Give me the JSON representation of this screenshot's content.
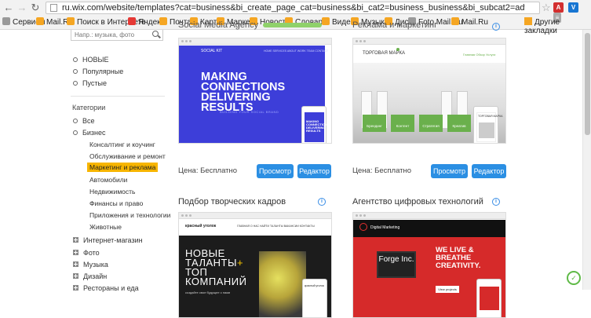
{
  "browser": {
    "url": "ru.wix.com/website/templates?cat=business&bi_create_page_cat=business&bi_cat2=business_business&bi_subcat2=advertising-marketing_advertising-m",
    "bookmarks": [
      "Сервисы",
      "Mail.Ru",
      "Поиск в Интернете",
      "Яндекс",
      "Почта",
      "Карты",
      "Маркет",
      "Новости",
      "Словари",
      "Видео",
      "Музыка",
      "Диск",
      "Foto.Mail.Ru",
      "Mail.Ru"
    ],
    "other_bookmarks": "Другие закладки"
  },
  "sidebar": {
    "search_placeholder": "Напр.: музыка, фото",
    "filters": [
      "НОВЫЕ",
      "Популярные",
      "Пустые"
    ],
    "categories_heading": "Категории",
    "categories": [
      {
        "label": "Все"
      },
      {
        "label": "Бизнес"
      },
      {
        "label": "Интернет-магазин"
      },
      {
        "label": "Фото"
      },
      {
        "label": "Музыка"
      },
      {
        "label": "Дизайн"
      },
      {
        "label": "Рестораны и еда"
      }
    ],
    "business_subcategories": [
      "Консалтинг и коучинг",
      "Обслуживание и ремонт",
      "Маркетинг и реклама",
      "Автомобили",
      "Недвижимость",
      "Финансы и право",
      "Приложения и технологии",
      "Животные"
    ]
  },
  "cards": [
    {
      "title": "Social Media Agency",
      "price": "Цена: Бесплатно",
      "view_label": "Просмотр",
      "edit_label": "Редактор",
      "preview": {
        "logo": "SOCIAL KIT",
        "nav": "HOME   SERVICES   ABOUT   WORK   TEAM   CONTACT",
        "headline": "MAKING CONNECTIONS DELIVERING RESULTS",
        "sub": "BUILDING YOUR SOCIAL BRAND",
        "phone_text": "MAKING CONNECTIONS DELIVERING RESULTS"
      }
    },
    {
      "title": "Реклама и маркетинг",
      "price": "Цена: Бесплатно",
      "view_label": "Просмотр",
      "edit_label": "Редактор",
      "preview": {
        "brand": "ТОРГОВАЯ МАРКА",
        "nav": "Главная   Обзор   Услуги",
        "tiles": [
          "Брендинг",
          "Контент",
          "Стратегия",
          "Креатив"
        ],
        "phone_brand": "ТОРГОВАЯ МАРКА"
      }
    },
    {
      "title": "Подбор творческих кадров",
      "preview": {
        "brand": "красный уголок",
        "nav": "ГЛАВНАЯ   О НАС   НАЙТИ ТАЛАНТЫ   ВАКАНСИИ   КОНТАКТЫ",
        "headline_lines": [
          "НОВЫЕ",
          "ТАЛАНТЫ",
          "ТОП",
          "КОМПАНИЙ"
        ],
        "plus": "+",
        "sub": "создайте свое будущее с нами",
        "phone_brand": "красный уголок"
      }
    },
    {
      "title": "Агентство цифровых технологий",
      "preview": {
        "brand": "Digital Marketing",
        "laptop_text": "Forge Inc.",
        "headline": "WE LIVE & BREATHE CREATIVITY.",
        "button": "View projects"
      }
    }
  ],
  "colors": {
    "accent": "#2b8fe3",
    "active_category": "#f7b500",
    "card1_hero": "#3d3ed9",
    "card2_green": "#6ab04c",
    "card4_red": "#d62a2a"
  }
}
